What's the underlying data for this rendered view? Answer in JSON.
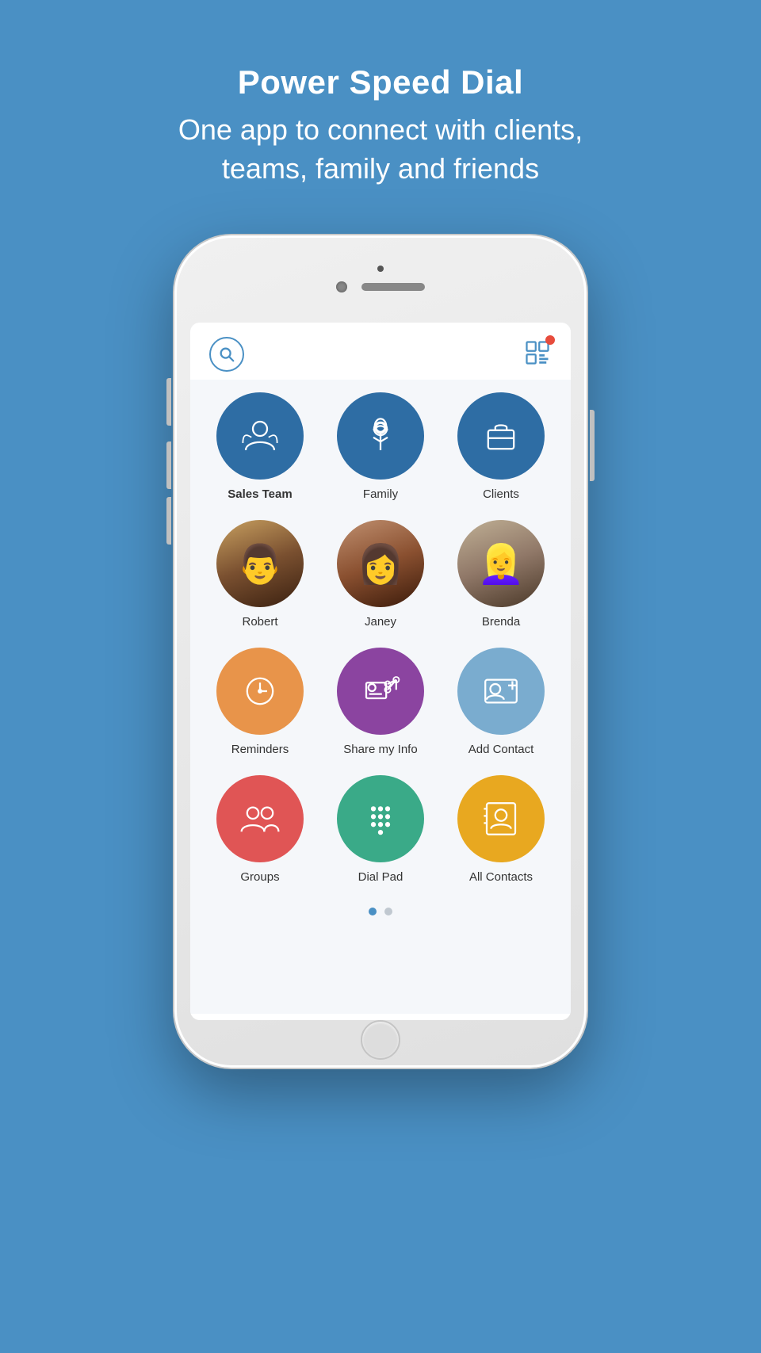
{
  "header": {
    "title": "Power Speed Dial",
    "subtitle": "One app to connect with clients,\nteams, family and friends"
  },
  "screen": {
    "topbar": {
      "search_aria": "Search",
      "list_aria": "Notifications"
    },
    "grid_rows": [
      [
        {
          "id": "sales-team",
          "label": "Sales Team",
          "bold": true,
          "type": "icon",
          "color": "#2e6da4",
          "icon": "person"
        },
        {
          "id": "family",
          "label": "Family",
          "bold": false,
          "type": "icon",
          "color": "#2e6da4",
          "icon": "balloon"
        },
        {
          "id": "clients",
          "label": "Clients",
          "bold": false,
          "type": "icon",
          "color": "#2e6da4",
          "icon": "briefcase"
        }
      ],
      [
        {
          "id": "robert",
          "label": "Robert",
          "bold": false,
          "type": "photo",
          "color": "#a0784a"
        },
        {
          "id": "janey",
          "label": "Janey",
          "bold": false,
          "type": "photo",
          "color": "#b07040"
        },
        {
          "id": "brenda",
          "label": "Brenda",
          "bold": false,
          "type": "photo",
          "color": "#907060"
        }
      ],
      [
        {
          "id": "reminders",
          "label": "Reminders",
          "bold": false,
          "type": "icon",
          "color": "#e8944a",
          "icon": "clock"
        },
        {
          "id": "share-my-info",
          "label": "Share my Info",
          "bold": false,
          "type": "icon",
          "color": "#8b44a0",
          "icon": "share"
        },
        {
          "id": "add-contact",
          "label": "Add Contact",
          "bold": false,
          "type": "icon",
          "color": "#7aaccf",
          "icon": "id-card"
        }
      ],
      [
        {
          "id": "groups",
          "label": "Groups",
          "bold": false,
          "type": "icon",
          "color": "#e05555",
          "icon": "group"
        },
        {
          "id": "dial-pad",
          "label": "Dial Pad",
          "bold": false,
          "type": "icon",
          "color": "#3aaa88",
          "icon": "dialpad"
        },
        {
          "id": "all-contacts",
          "label": "All Contacts",
          "bold": false,
          "type": "icon",
          "color": "#e8a820",
          "icon": "contacts"
        }
      ]
    ],
    "pagination": {
      "active": 0,
      "total": 2
    }
  },
  "settings_icon": "⚙"
}
